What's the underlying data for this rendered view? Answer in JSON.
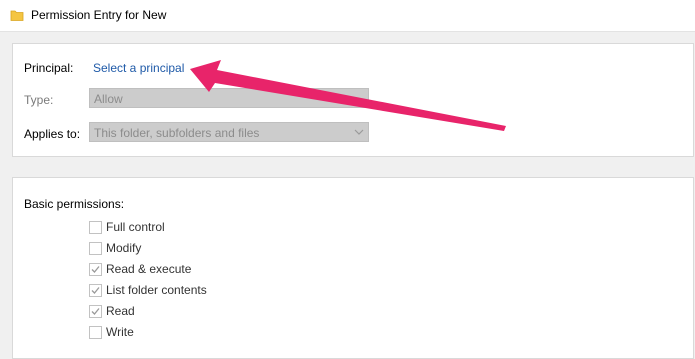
{
  "window": {
    "title": "Permission Entry for New"
  },
  "principal": {
    "label": "Principal:",
    "link": "Select a principal"
  },
  "type": {
    "label": "Type:",
    "value": "Allow"
  },
  "applies_to": {
    "label": "Applies to:",
    "value": "This folder, subfolders and files"
  },
  "permissions": {
    "heading": "Basic permissions:",
    "items": [
      {
        "label": "Full control",
        "checked": false
      },
      {
        "label": "Modify",
        "checked": false
      },
      {
        "label": "Read & execute",
        "checked": true
      },
      {
        "label": "List folder contents",
        "checked": true
      },
      {
        "label": "Read",
        "checked": true
      },
      {
        "label": "Write",
        "checked": false
      }
    ]
  },
  "colors": {
    "arrow": "#e8246a",
    "link": "#1f5aa8",
    "folder": "#f4c542"
  }
}
